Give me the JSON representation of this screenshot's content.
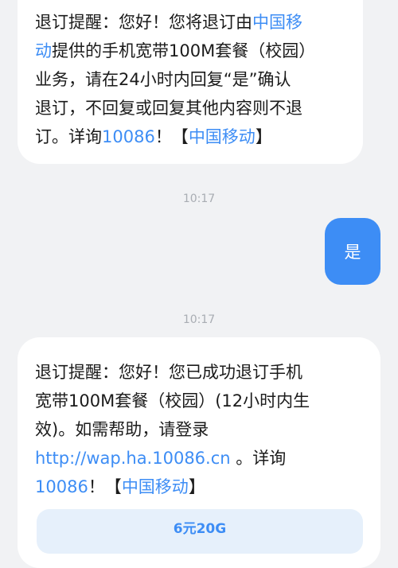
{
  "messages": {
    "first": {
      "line1_pre": "退订提醒：您好！您将退订由",
      "line1_link": "中国移",
      "line2_link": "动",
      "line2_rest": "提供的手机宽带100M套餐（校园）",
      "line3": "业务，请在24小时内回复“是”确认",
      "line4": "退订，不回复或回复其他内容则不退",
      "line5_pre": "订。详询",
      "line5_phone": "10086",
      "line5_mid": "！【",
      "line5_brand": "中国移动",
      "line5_end": "】"
    },
    "timestamp1": "10:17",
    "reply": "是",
    "timestamp2": "10:17",
    "second": {
      "line1": "退订提醒：您好！您已成功退订手机",
      "line2": "宽带100M套餐（校园）(12小时内生",
      "line3": "效)。如需帮助，请登录",
      "line4_url": "http://wap.ha.10086.cn",
      "line4_rest": " 。详询",
      "line5_phone": "10086",
      "line5_mid": "！【",
      "line5_brand": "中国移动",
      "line5_end": "】"
    },
    "promo_card": "6元20G"
  },
  "colors": {
    "background": "#f1f2f4",
    "incoming_bubble": "#ffffff",
    "outgoing_bubble": "#3d8df5",
    "link": "#3d8df5",
    "timestamp": "#a9adb3",
    "promo_card": "#e6f0fb"
  }
}
